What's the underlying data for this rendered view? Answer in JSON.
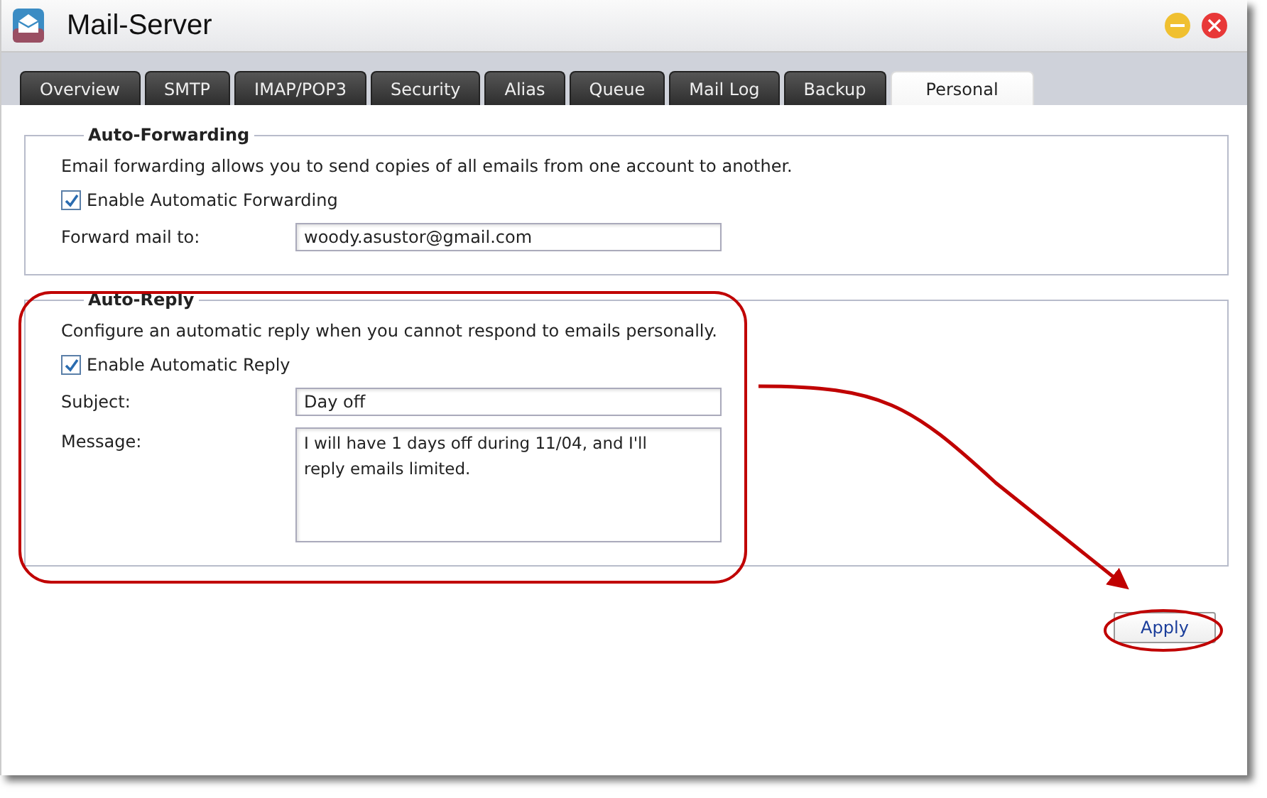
{
  "window": {
    "title": "Mail-Server"
  },
  "tabs": [
    {
      "label": "Overview",
      "selected": false
    },
    {
      "label": "SMTP",
      "selected": false
    },
    {
      "label": "IMAP/POP3",
      "selected": false
    },
    {
      "label": "Security",
      "selected": false
    },
    {
      "label": "Alias",
      "selected": false
    },
    {
      "label": "Queue",
      "selected": false
    },
    {
      "label": "Mail Log",
      "selected": false
    },
    {
      "label": "Backup",
      "selected": false
    },
    {
      "label": "Personal",
      "selected": true
    }
  ],
  "sections": [
    {
      "title": "Auto-Forwarding",
      "description": "Email forwarding allows you to send copies of all emails from one account to another.",
      "checkbox": {
        "label": "Enable Automatic Forwarding",
        "checked": true
      },
      "fields": [
        {
          "kind": "input",
          "label": "Forward mail to:",
          "value": "woody.asustor@gmail.com"
        }
      ]
    },
    {
      "title": "Auto-Reply",
      "description": "Configure an automatic reply when you cannot respond to emails personally.",
      "checkbox": {
        "label": "Enable Automatic Reply",
        "checked": true
      },
      "fields": [
        {
          "kind": "input",
          "label": "Subject:",
          "value": "Day off"
        },
        {
          "kind": "textarea",
          "label": "Message:",
          "value": "I will have 1 days off during 11/04, and I'll reply emails limited."
        }
      ]
    }
  ],
  "buttons": [
    "Apply"
  ]
}
